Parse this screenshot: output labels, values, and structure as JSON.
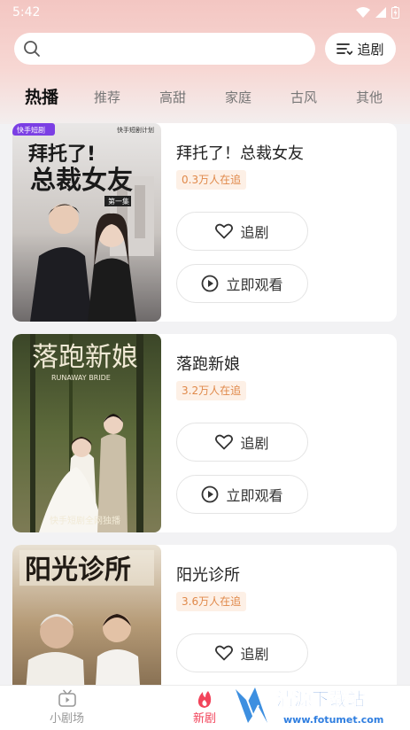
{
  "status": {
    "time": "5:42"
  },
  "search": {
    "placeholder": "",
    "follow_label": "追剧"
  },
  "tabs": [
    {
      "label": "热播",
      "active": true
    },
    {
      "label": "推荐"
    },
    {
      "label": "高甜"
    },
    {
      "label": "家庭"
    },
    {
      "label": "古风"
    },
    {
      "label": "其他"
    }
  ],
  "dramas": [
    {
      "title": "拜托了！总裁女友",
      "watch_count": "0.3万人在追",
      "follow_label": "追剧",
      "watch_label": "立即观看",
      "poster_title": "拜托了！总裁女友",
      "poster_badge": "快手短剧",
      "poster_top_text": "快手短剧计划",
      "poster_episode": "第一集"
    },
    {
      "title": "落跑新娘",
      "watch_count": "3.2万人在追",
      "follow_label": "追剧",
      "watch_label": "立即观看",
      "poster_title": "落跑新娘",
      "poster_subtitle": "RUNAWAY BRIDE",
      "poster_bottom_text": "快手短剧全网独播"
    },
    {
      "title": "阳光诊所",
      "watch_count": "3.6万人在追",
      "follow_label": "追剧",
      "poster_title": "阳光诊所"
    }
  ],
  "bottom_nav": [
    {
      "label": "小剧场",
      "icon": "tv-icon",
      "active": false
    },
    {
      "label": "新剧",
      "icon": "flame-icon",
      "active": true
    }
  ],
  "watermark": {
    "text": "清源下载站",
    "url": "www.fotumet.com"
  },
  "colors": {
    "accent": "#f2445b",
    "badge_text": "#e0894a",
    "badge_bg": "#fdf0e6"
  }
}
